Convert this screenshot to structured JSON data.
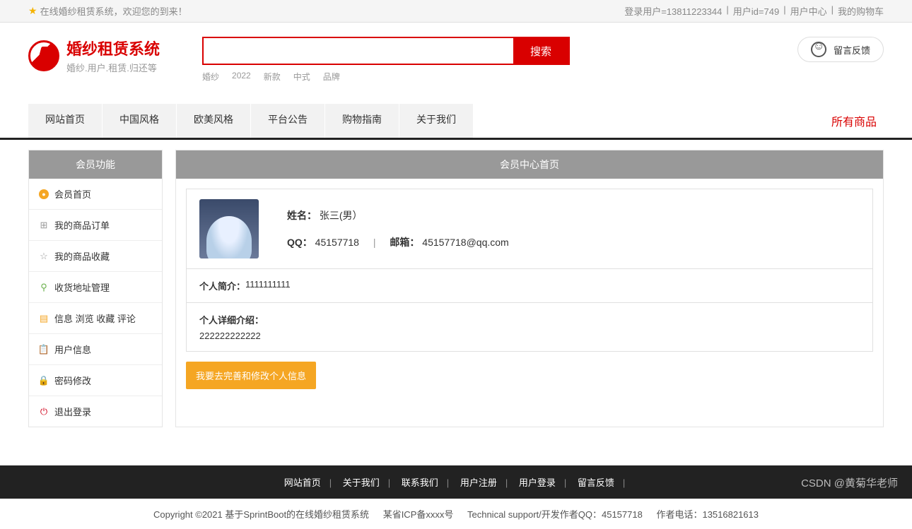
{
  "topbar": {
    "welcome": "在线婚纱租赁系统，欢迎您的到来！",
    "user_label": "登录用户=13811223344",
    "uid_label": "用户id=749",
    "user_center": "用户中心",
    "cart": "我的购物车"
  },
  "logo": {
    "title": "婚纱租赁系统",
    "subtitle": "婚纱.用户.租赁.归还等"
  },
  "search": {
    "button": "搜索",
    "value": "",
    "tags": [
      "婚纱",
      "2022",
      "新款",
      "中式",
      "品牌"
    ]
  },
  "feedback": {
    "label": "留言反馈"
  },
  "nav": {
    "items": [
      "网站首页",
      "中国风格",
      "欧美风格",
      "平台公告",
      "购物指南",
      "关于我们"
    ],
    "right": "所有商品"
  },
  "sidebar": {
    "title": "会员功能",
    "items": [
      {
        "label": "会员首页"
      },
      {
        "label": "我的商品订单"
      },
      {
        "label": "我的商品收藏"
      },
      {
        "label": "收货地址管理"
      },
      {
        "label": "信息 浏览 收藏 评论"
      },
      {
        "label": "用户信息"
      },
      {
        "label": "密码修改"
      },
      {
        "label": "退出登录"
      }
    ]
  },
  "content": {
    "title": "会员中心首页",
    "name_label": "姓名：",
    "name_value": "张三(男）",
    "qq_label": "QQ：",
    "qq_value": "45157718",
    "email_label": "邮箱：",
    "email_value": "45157718@qq.com",
    "bio_label": "个人简介：",
    "bio_value": "1111111111",
    "detail_label": "个人详细介绍：",
    "detail_value": "222222222222",
    "edit_btn": "我要去完善和修改个人信息"
  },
  "footer": {
    "links": [
      "网站首页",
      "关于我们",
      "联系我们",
      "用户注册",
      "用户登录",
      "留言反馈"
    ]
  },
  "copyright": {
    "text": "Copyright ©2021 基于SprintBoot的在线婚纱租赁系统",
    "icp": "某省ICP备xxxx号",
    "tech": "Technical support/开发作者QQ：45157718",
    "phone": "作者电话：13516821613"
  },
  "watermark": "CSDN @黄菊华老师"
}
